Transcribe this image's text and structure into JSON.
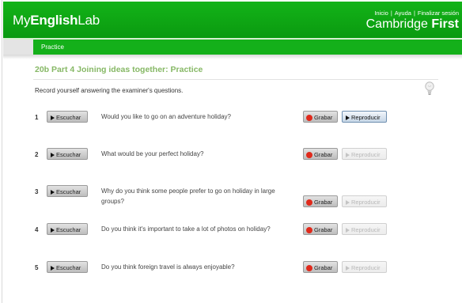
{
  "header": {
    "brand_part1": "My",
    "brand_part2": "English",
    "brand_part3": "Lab",
    "links": [
      "Inicio",
      "Ayuda",
      "Finalizar sesión"
    ],
    "link_separator": "|",
    "product_part1": "Cambridge ",
    "product_part2": "First",
    "colors": {
      "header_green": "#13b318",
      "title_green": "#86b865"
    }
  },
  "nav": {
    "tab_label": "Practice"
  },
  "activity": {
    "title": "20b Part 4 Joining ideas together: Practice",
    "instructions": "Record yourself answering the examiner's questions."
  },
  "buttons": {
    "listen_label": "Escuchar",
    "record_label": "Grabar",
    "play_label": "Reproducir"
  },
  "questions": [
    {
      "number": "1",
      "text": "Would you like to go on an adventure holiday?",
      "play_enabled": true
    },
    {
      "number": "2",
      "text": "What would be your perfect holiday?",
      "play_enabled": false
    },
    {
      "number": "3",
      "text": "Why do you think some people prefer to go on holiday in large groups?",
      "play_enabled": false
    },
    {
      "number": "4",
      "text": "Do you think it's important to take a lot of photos on holiday?",
      "play_enabled": false
    },
    {
      "number": "5",
      "text": "Do you think foreign travel is always enjoyable?",
      "play_enabled": false
    }
  ],
  "icons": {
    "hint": "lightbulb-icon",
    "listen": "play-triangle-icon",
    "record": "record-dot-icon"
  }
}
